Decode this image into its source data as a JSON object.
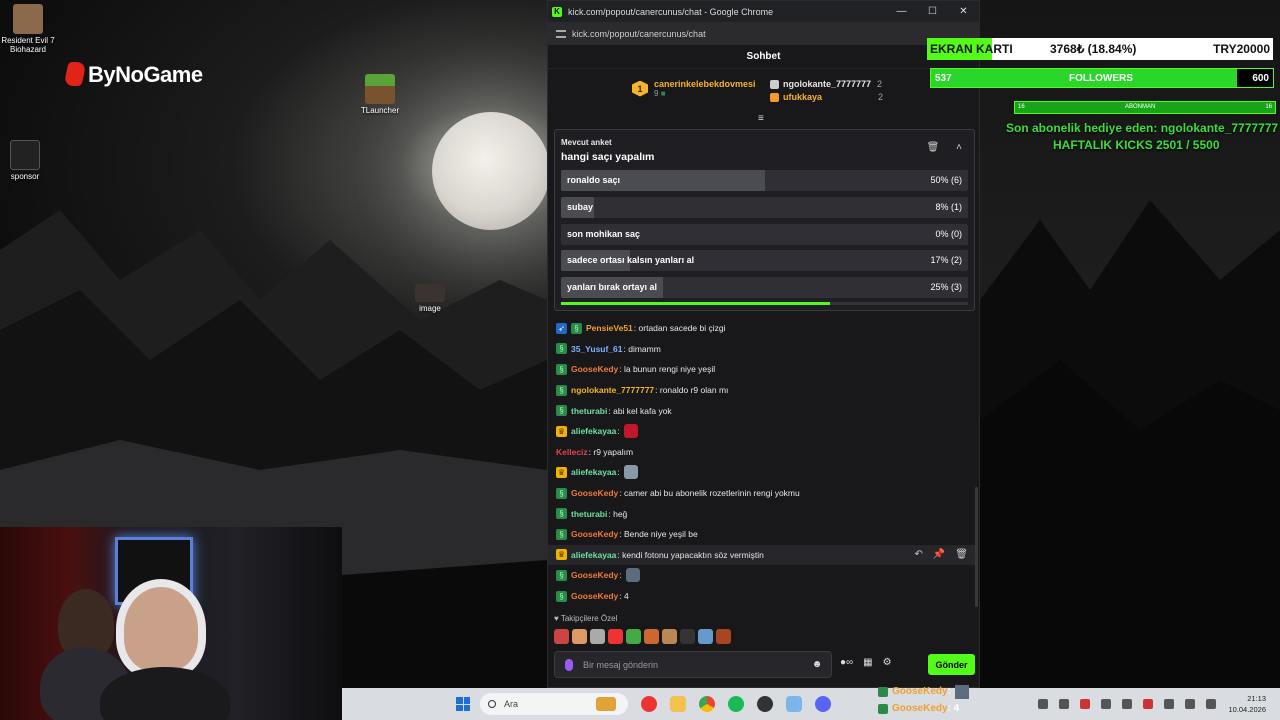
{
  "desktop": {
    "icons": [
      {
        "label": "Resident Evil 7 Biohazard"
      },
      {
        "label": "sponsor"
      },
      {
        "label": "TLauncher"
      },
      {
        "label": "image"
      }
    ],
    "brand_overlay": "ByNoGame"
  },
  "browser": {
    "window_title": "kick.com/popout/canercunus/chat - Google Chrome",
    "url": "kick.com/popout/canercunus/chat",
    "controls": {
      "minimize": "—",
      "maximize": "☐",
      "close": "✕"
    }
  },
  "chat": {
    "header": "Sohbet",
    "top_gifter": {
      "rank": "1",
      "name": "canerinkelebekdovmesi",
      "count": "9"
    },
    "gifters": [
      {
        "name": "ngolokante_7777777",
        "count": "2",
        "color": "#e6e6e6"
      },
      {
        "name": "ufukkaya",
        "count": "2",
        "color": "#f5b42a"
      }
    ],
    "poll": {
      "label": "Mevcut anket",
      "question": "hangi saçı yapalım",
      "options": [
        {
          "text": "ronaldo saçı",
          "percent": "50% (6)",
          "fraction": 0.5
        },
        {
          "text": "subay",
          "percent": "8% (1)",
          "fraction": 0.08
        },
        {
          "text": "son mohikan saç",
          "percent": "0% (0)",
          "fraction": 0.0
        },
        {
          "text": "sadece ortası kalsın yanları al",
          "percent": "17% (2)",
          "fraction": 0.17
        },
        {
          "text": "yanları bırak ortayı al",
          "percent": "25% (3)",
          "fraction": 0.25
        }
      ],
      "time_remaining_fraction": 0.66
    },
    "messages": [
      {
        "user": "PensieVe51",
        "text": ": ortadan sacede bi çizgi",
        "color": "#f0a030",
        "badges": [
          "gift",
          "sub"
        ]
      },
      {
        "user": "35_Yusuf_61",
        "text": ": dimamm",
        "color": "#7fb4ff",
        "badges": [
          "sub"
        ]
      },
      {
        "user": "GooseKedy",
        "text": ": la bunun rengi niye yeşil",
        "color": "#f07a3a",
        "badges": [
          "sub"
        ]
      },
      {
        "user": "ngolokante_7777777",
        "text": ": ronaldo r9 olan mı",
        "color": "#f5b42a",
        "badges": [
          "sub"
        ]
      },
      {
        "user": "theturabi",
        "text": ": abi kel kafa yok",
        "color": "#6ee0a0",
        "badges": [
          "sub"
        ]
      },
      {
        "user": "aliefekayaa",
        "text": ":",
        "color": "#6ee0a0",
        "badges": [
          "crown"
        ],
        "emote": "#c0182a"
      },
      {
        "user": "Kelleciz",
        "text": ": r9 yapalım",
        "color": "#e0434f",
        "badges": []
      },
      {
        "user": "aliefekayaa",
        "text": ":",
        "color": "#6ee0a0",
        "badges": [
          "crown"
        ],
        "emote": "#8899aa"
      },
      {
        "user": "GooseKedy",
        "text": ": camer abi bu abonelik rozetlerinin rengi yokmu",
        "color": "#f07a3a",
        "badges": [
          "sub"
        ]
      },
      {
        "user": "theturabi",
        "text": ": heğ",
        "color": "#6ee0a0",
        "badges": [
          "sub"
        ]
      },
      {
        "user": "GooseKedy",
        "text": ": Bende niye yeşil be",
        "color": "#f07a3a",
        "badges": [
          "sub"
        ]
      },
      {
        "user": "aliefekayaa",
        "text": ": kendi fotonu yapacaktın söz vermiştin",
        "color": "#6ee0a0",
        "badges": [
          "crown"
        ],
        "highlighted": true
      },
      {
        "user": "GooseKedy",
        "text": ":",
        "color": "#f07a3a",
        "badges": [
          "sub"
        ],
        "emote": "#5d6b7e"
      },
      {
        "user": "GooseKedy",
        "text": ": 4",
        "color": "#f07a3a",
        "badges": [
          "sub"
        ]
      }
    ],
    "message_actions": {
      "reply": "↶",
      "pin": "📌",
      "delete": "🗑"
    },
    "emote_section_label": "Takipçilere Özel",
    "emotes": [
      "#c44",
      "#d96",
      "#aaa",
      "#e33",
      "#4a4",
      "#c63",
      "#b85",
      "#333",
      "#69c",
      "#a42"
    ],
    "input": {
      "placeholder": "Bir mesaj gönderin"
    },
    "send_button": "Gönder"
  },
  "overlays": {
    "gpu": {
      "label": "EKRAN KARTI",
      "progress": "3768₺ (18.84%)",
      "target": "TRY20000",
      "fraction": 0.1884
    },
    "followers": {
      "current": "537",
      "label": "FOLLOWERS",
      "goal": "600",
      "fraction": 0.895
    },
    "subs": {
      "start": "16",
      "label": "ABONMAN",
      "end": "16"
    },
    "gift_text": "Son abonelik hediye eden: ngolokante_7777777",
    "kicks_text": "HAFTALIK KICKS 2501 / 5500",
    "bottom_chat": [
      {
        "user": "GooseKedy",
        "text": ":"
      },
      {
        "user": "GooseKedy",
        "text": ": 4"
      }
    ]
  },
  "taskbar": {
    "search": "Ara",
    "time": "21:13",
    "date": "10.04.2026"
  }
}
